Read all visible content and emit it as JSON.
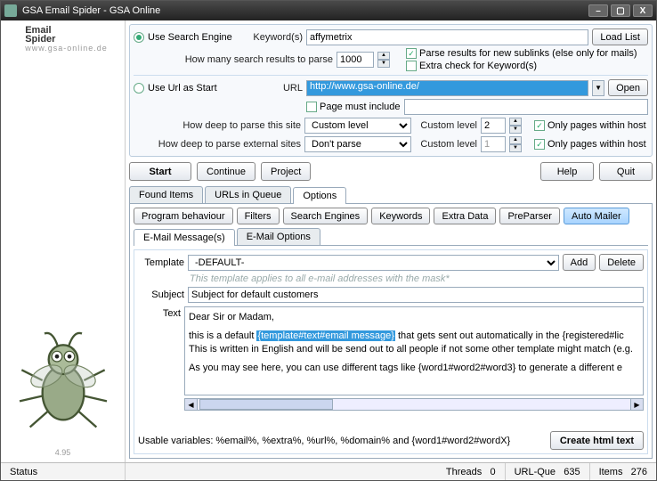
{
  "window": {
    "title": "GSA Email Spider        - GSA Online"
  },
  "sidebar": {
    "logo_line1": "Email",
    "logo_line2": "Spider",
    "logo_sub": "www.gsa-online.de",
    "version": "4.95"
  },
  "search": {
    "mode_search_label": "Use Search Engine",
    "mode_url_label": "Use Url as Start",
    "keywords_label": "Keyword(s)",
    "keywords_value": "affymetrix",
    "load_list": "Load List",
    "results_label": "How many search results to parse",
    "results_value": "1000",
    "parse_sublinks": "Parse results for new sublinks (else only for mails)",
    "extra_check": "Extra check for Keyword(s)",
    "url_label": "URL",
    "url_value": "http://www.gsa-online.de/",
    "open": "Open",
    "page_include": "Page must include",
    "deep_site_label": "How deep to parse this site",
    "deep_site_value": "Custom level",
    "deep_site_custom_label": "Custom level",
    "deep_site_custom_value": "2",
    "deep_ext_label": "How deep to parse external sites",
    "deep_ext_value": "Don't parse",
    "deep_ext_custom_label": "Custom level",
    "deep_ext_custom_value": "1",
    "within_host": "Only pages within host"
  },
  "actions": {
    "start": "Start",
    "continue": "Continue",
    "project": "Project",
    "help": "Help",
    "quit": "Quit"
  },
  "main_tabs": [
    "Found Items",
    "URLs in Queue",
    "Options"
  ],
  "option_buttons": [
    "Program behaviour",
    "Filters",
    "Search Engines",
    "Keywords",
    "Extra Data",
    "PreParser",
    "Auto Mailer"
  ],
  "sub_tabs": [
    "E-Mail Message(s)",
    "E-Mail Options"
  ],
  "mailer": {
    "template_label": "Template",
    "template_value": "-DEFAULT-",
    "add": "Add",
    "delete": "Delete",
    "template_hint": "This template applies to all e-mail addresses with the mask*",
    "subject_label": "Subject",
    "subject_value": "Subject for default customers",
    "text_label": "Text",
    "body_line1": "Dear Sir or Madam,",
    "body_line2a": "this is a default ",
    "body_line2_hl": "{template#text#email message}",
    "body_line2b": " that gets sent out automatically in the {registered#lic",
    "body_line3": "This is written in English and will be send out to all people if not some other template might match (e.g.",
    "body_line4": "As you may see here, you can use different tags like {word1#word2#word3} to generate a different e",
    "usable_vars": "Usable variables: %email%, %extra%, %url%, %domain% and {word1#word2#wordX}",
    "create_html": "Create html text"
  },
  "status": {
    "status_label": "Status",
    "threads_label": "Threads",
    "threads_value": "0",
    "urlque_label": "URL-Que",
    "urlque_value": "635",
    "items_label": "Items",
    "items_value": "276"
  }
}
